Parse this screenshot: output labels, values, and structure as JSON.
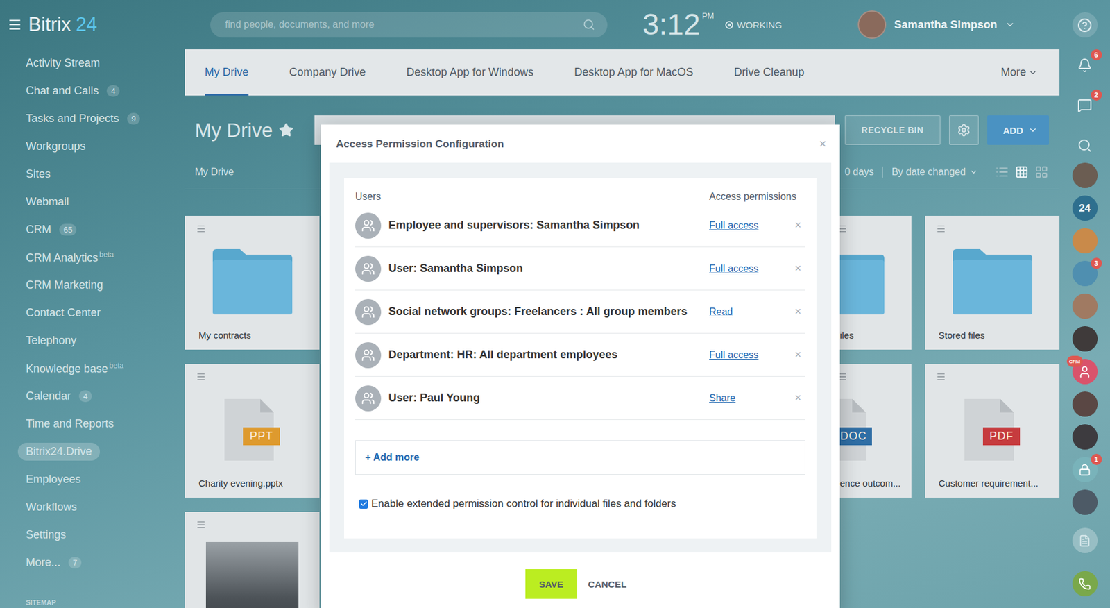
{
  "logo": {
    "name": "Bitrix",
    "suffix": "24"
  },
  "header": {
    "search": {
      "placeholder": "find people, documents, and more"
    },
    "clock": {
      "time": "3:12",
      "period": "PM"
    },
    "status": "WORKING",
    "user": {
      "name": "Samantha Simpson"
    }
  },
  "sidebar": {
    "items": [
      {
        "label": "Activity Stream",
        "selected": false
      },
      {
        "label": "Chat and Calls",
        "counter": "4",
        "selected": false
      },
      {
        "label": "Tasks and Projects",
        "counter": "9",
        "selected": false
      },
      {
        "label": "Workgroups",
        "selected": false
      },
      {
        "label": "Sites",
        "selected": false
      },
      {
        "label": "Webmail",
        "selected": false
      },
      {
        "label": "CRM",
        "counter": "65",
        "selected": false
      },
      {
        "label": "CRM Analytics",
        "sup": "beta",
        "selected": false
      },
      {
        "label": "CRM Marketing",
        "selected": false
      },
      {
        "label": "Contact Center",
        "selected": false
      },
      {
        "label": "Telephony",
        "selected": false
      },
      {
        "label": "Knowledge base",
        "sup": "beta",
        "selected": false
      },
      {
        "label": "Calendar",
        "counter": "4",
        "selected": false
      },
      {
        "label": "Time and Reports",
        "selected": false
      },
      {
        "label": "Bitrix24.Drive",
        "selected": true
      },
      {
        "label": "Employees",
        "selected": false
      },
      {
        "label": "Workflows",
        "selected": false
      },
      {
        "label": "Settings",
        "selected": false
      },
      {
        "label": "More...",
        "counter": "7",
        "selected": false
      }
    ],
    "footer": "SITEMAP"
  },
  "tabs": [
    {
      "label": "My Drive",
      "kind": "link",
      "selected": true
    },
    {
      "label": "Company Drive",
      "kind": "link",
      "selected": false
    },
    {
      "label": "Desktop App for Windows",
      "kind": "link",
      "selected": false
    },
    {
      "label": "Desktop App for MacOS",
      "kind": "link",
      "selected": false
    },
    {
      "label": "Drive Cleanup",
      "kind": "link",
      "selected": false
    },
    {
      "label": "More",
      "kind": "dropdown",
      "selected": false
    }
  ],
  "toolbar": {
    "title": "My Drive",
    "recycle_bin": "RECYCLE BIN",
    "add": "ADD"
  },
  "filter": {
    "breadcrumb": "My Drive",
    "period": "0 days",
    "sort": "By date changed",
    "views": [
      {
        "kind": "list",
        "selected": false
      },
      {
        "kind": "grid",
        "selected": true
      },
      {
        "kind": "tiles",
        "selected": false
      }
    ]
  },
  "tiles": {
    "left": [
      {
        "kind": "folder",
        "name": "My contracts"
      },
      {
        "kind": "file",
        "name": "Charity evening.pptx",
        "ext": "PPT",
        "color": "#de9a2e"
      },
      {
        "kind": "photo"
      }
    ],
    "clipped": [
      {
        "kind": "folder",
        "name": "iles"
      },
      {
        "kind": "file",
        "name": "ence outcom...",
        "ext": "DOC",
        "color": "#2f6ea5"
      }
    ],
    "right": [
      {
        "kind": "folder",
        "name": "Stored files"
      },
      {
        "kind": "file",
        "name": "Customer requirement...",
        "ext": "PDF",
        "color": "#c63b3e"
      }
    ]
  },
  "dialog": {
    "title": "Access Permission Configuration",
    "close": "×",
    "columns": [
      "Users",
      "Access permissions"
    ],
    "rows": [
      {
        "user": "Employee and supervisors: Samantha Simpson",
        "permission": "Full access",
        "remove": "×"
      },
      {
        "user": "User: Samantha Simpson",
        "permission": "Full access",
        "remove": "×"
      },
      {
        "user": "Social network groups: Freelancers : All group members",
        "permission": "Read",
        "remove": "×"
      },
      {
        "user": "Department: HR: All department employees",
        "permission": "Full access",
        "remove": "×"
      },
      {
        "user": "User: Paul Young",
        "permission": "Share",
        "remove": "×"
      }
    ],
    "add_more": "+ Add more",
    "extended": {
      "label": "Enable extended permission control for individual files and folders",
      "checked": true
    },
    "buttons": [
      {
        "label": "SAVE",
        "kind": "primary"
      },
      {
        "label": "CANCEL",
        "kind": "link"
      }
    ]
  },
  "rail": {
    "top": [
      {
        "kind": "help"
      },
      {
        "kind": "notifications",
        "badge": "6"
      },
      {
        "kind": "chat",
        "badge": "2"
      },
      {
        "kind": "search"
      }
    ],
    "contacts": [
      {
        "kind": "avatar",
        "color": "#6b5d52"
      },
      {
        "kind": "app",
        "label": "24"
      },
      {
        "kind": "avatar",
        "color": "#c98a4a"
      },
      {
        "kind": "avatar",
        "color": "#4f8fb0",
        "badge": "3"
      },
      {
        "kind": "avatar",
        "color": "#a07a62"
      },
      {
        "kind": "avatar",
        "color": "#3f3a3a"
      },
      {
        "kind": "crm",
        "badge": "CRM"
      },
      {
        "kind": "avatar",
        "color": "#5a4744"
      },
      {
        "kind": "avatar",
        "color": "#3d3b3f"
      },
      {
        "kind": "lock",
        "badge": "1"
      },
      {
        "kind": "avatar",
        "color": "#4d5a66"
      }
    ],
    "bottom": [
      {
        "kind": "doc"
      },
      {
        "kind": "phone"
      }
    ]
  }
}
